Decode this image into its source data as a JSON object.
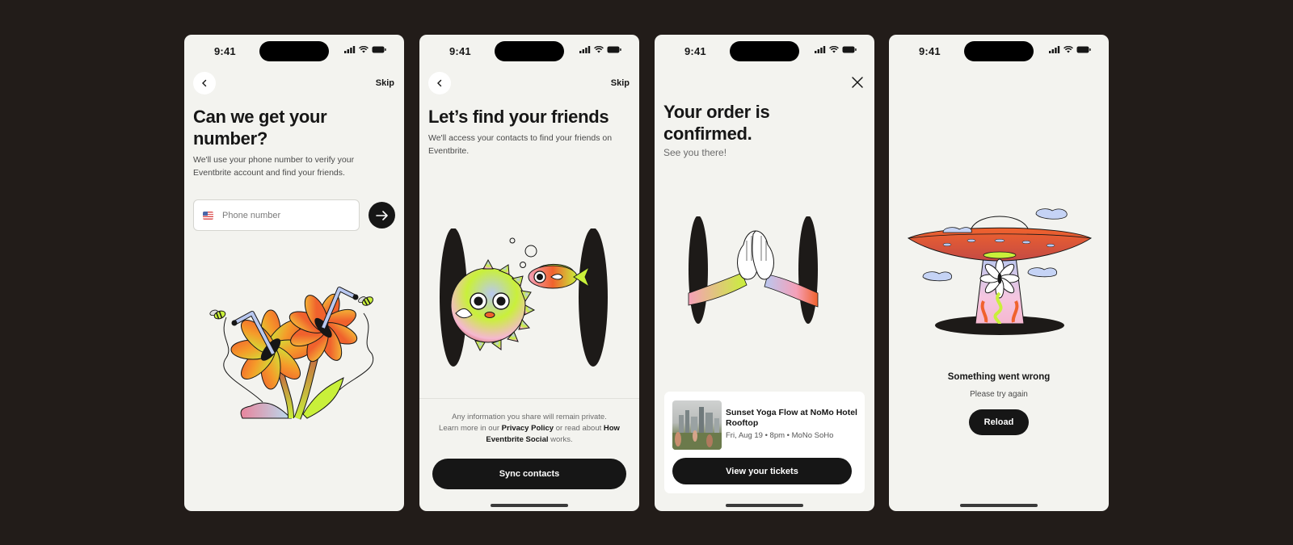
{
  "status_bar": {
    "time": "9:41"
  },
  "screens": [
    {
      "id": "phone-number",
      "skip_label": "Skip",
      "title_line1": "Can we get your",
      "title_line2": "number?",
      "subtitle_line1": "We'll use your phone number to verify your",
      "subtitle_line2": "Eventbrite account and find your friends.",
      "input": {
        "placeholder": "Phone number",
        "value": "",
        "country_flag": "US"
      },
      "submit_icon": "arrow-right-icon",
      "illustration": "flowers-with-straws-and-bees"
    },
    {
      "id": "find-friends",
      "skip_label": "Skip",
      "title": "Let’s find your friends",
      "subtitle_line1": "We'll access your contacts to find your friends on",
      "subtitle_line2": "Eventbrite.",
      "illustration": "pufferfish-and-fish-through-holes",
      "privacy": {
        "line1": "Any information you share will remain private.",
        "line2_prefix": "Learn more in our ",
        "privacy_link": "Privacy Policy",
        "line2_middle": " or read about ",
        "social_link_a": "How",
        "social_link_b": "Eventbrite Social",
        "suffix": " works."
      },
      "button_label": "Sync contacts"
    },
    {
      "id": "order-confirmed",
      "close_icon": "close-icon",
      "title_line1": "Your order is",
      "title_line2": "confirmed.",
      "subtitle": "See you there!",
      "illustration": "high-five-through-holes",
      "event": {
        "title": "Sunset Yoga Flow at NoMo Hotel Rooftop",
        "meta": "Fri, Aug 19 • 8pm • MoNo SoHo"
      },
      "button_label": "View your tickets"
    },
    {
      "id": "error",
      "illustration": "ufo-beaming-flower",
      "title": "Something went wrong",
      "subtitle": "Please try again",
      "button_label": "Reload"
    }
  ],
  "colors": {
    "background": "#221c19",
    "screen": "#f3f3ef",
    "primary_button": "#161616",
    "accent_orange": "#f0622d"
  }
}
